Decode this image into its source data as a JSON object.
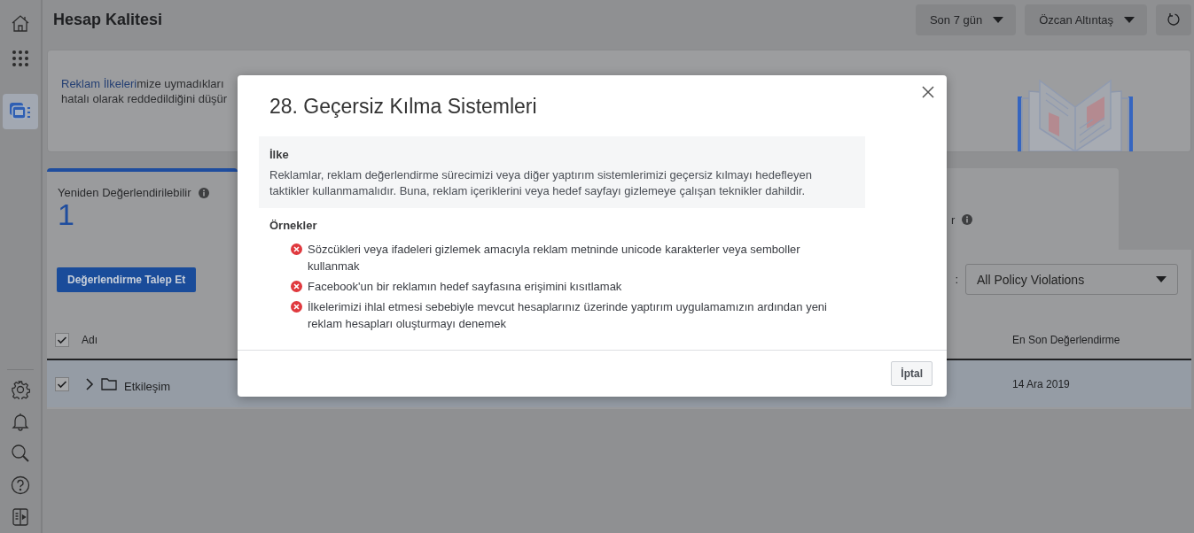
{
  "sidebar": {
    "items": [
      {
        "selected": false
      },
      {
        "selected": false
      },
      {
        "selected": true
      }
    ]
  },
  "header": {
    "title": "Hesap Kalitesi",
    "date_range": "Son 7 gün",
    "account": "Özcan Altıntaş"
  },
  "banner": {
    "link": "Reklam İlkeleri",
    "line_1_rest": "mize uymadıkları",
    "line_2": "hatalı olarak reddedildiğini düşür"
  },
  "stats": [
    {
      "label": "Yeniden Değerlendirilebilir",
      "value": "1",
      "selected": true
    },
    {
      "label": "r",
      "selected": false
    }
  ],
  "toolbar": {
    "request_button": "Değerlendirme Talep Et",
    "filter_label_end": ":",
    "filter_value": "All Policy Violations"
  },
  "table": {
    "header_checked": true,
    "columns": [
      "Adı",
      "En Son Değerlendirme"
    ],
    "rows": [
      {
        "checked": true,
        "expanded": false,
        "name": "Etkileşim",
        "last_review": "14 Ara 2019"
      }
    ]
  },
  "dialog": {
    "title": "28. Geçersiz Kılma Sistemleri",
    "policy_heading": "İlke",
    "policy_text": "Reklamlar, reklam değerlendirme sürecimizi veya diğer yaptırım sistemlerimizi geçersiz kılmayı hedefleyen taktikler kullanmamalıdır. Buna, reklam içeriklerini veya hedef sayfayı gizlemeye çalışan teknikler dahildir.",
    "examples_heading": "Örnekler",
    "examples": [
      "Sözcükleri veya ifadeleri gizlemek amacıyla reklam metninde unicode karakterler veya semboller kullanmak",
      "Facebook'un bir reklamın hedef sayfasına erişimini kısıtlamak",
      "İlkelerimizi ihlal etmesi sebebiyle mevcut hesaplarınız üzerinde yaptırım uygulamamızın ardından yeni reklam hesapları oluşturmayı denemek"
    ],
    "cancel_button": "İptal"
  }
}
